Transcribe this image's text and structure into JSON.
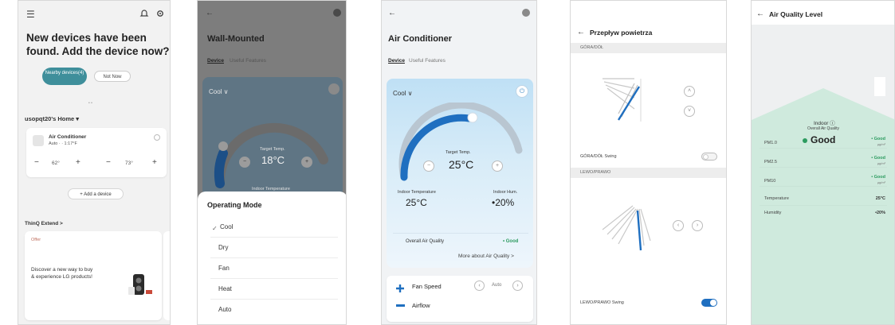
{
  "screen1": {
    "title": "New devices have been found. Add the device now?",
    "nearby_button": "Nearby devices(4)",
    "not_now_button": "Not Now",
    "page_dots": "• •",
    "home_label": "usopqt20's Home ▾",
    "device_name": "Air Conditioner",
    "device_status": "Auto · · 1:17°F",
    "minus": "−",
    "plus": "+",
    "temp_a": "62°",
    "temp_b": "73°",
    "add_device": "+ Add a device",
    "thinq_label": "ThinQ Extend >",
    "offer_label": "Offer",
    "promo_text": "Discover a new way to buy & experience LG products!"
  },
  "screen2": {
    "title": "Wall-Mounted",
    "tab_device": "Device",
    "tab_features": "Useful Features",
    "mode": "Cool ∨",
    "target_label": "Target Temp.",
    "target_value": "18°C",
    "partial_label": "Indoor Temperature",
    "sheet_title": "Operating Mode",
    "check": "✓",
    "modes": [
      "Cool",
      "Dry",
      "Fan",
      "Heat",
      "Auto"
    ]
  },
  "screen3": {
    "title": "Air Conditioner",
    "tab_device": "Device",
    "tab_features": "Useful Features",
    "mode": "Cool ∨",
    "target_label": "Target Temp.",
    "target_value": "25°C",
    "indoor_temp_label": "Indoor Temperature",
    "indoor_temp_value": "25°C",
    "indoor_hum_label": "Indoor Hum.",
    "indoor_hum_value": "•20%",
    "overall_label": "Overall Air Quality",
    "overall_value": "• Good",
    "more_link": "More about Air Quality >",
    "fan_speed_label": "Fan Speed",
    "fan_speed_value": "Auto",
    "airflow_label": "Airflow",
    "arrow_left": "‹",
    "arrow_right": "›"
  },
  "screen4": {
    "title": "Przepływ powietrza",
    "section_updown": "GÓRA/DÓŁ",
    "updown_swing": "GÓRA/DÓŁ Swing",
    "section_leftright": "LEWO/PRAWO",
    "leftright_swing": "LEWO/PRAWO Swing",
    "up_glyph": "˄",
    "down_glyph": "˅",
    "left_glyph": "‹",
    "right_glyph": "›"
  },
  "screen5": {
    "title": "Air Quality Level",
    "indoor_label": "Indoor ⓘ",
    "overall_label": "Overall Air Quality",
    "overall_value": "Good",
    "rows": [
      {
        "label": "PM1.0",
        "value": "• Good",
        "unit": "µg/m³"
      },
      {
        "label": "PM2.5",
        "value": "• Good",
        "unit": "µg/m³"
      },
      {
        "label": "PM10",
        "value": "• Good",
        "unit": "µg/m³"
      },
      {
        "label": "Temperature",
        "value": "25°C",
        "unit": ""
      },
      {
        "label": "Humidity",
        "value": "•20%",
        "unit": ""
      }
    ]
  },
  "colors": {
    "teal_button": "#3f8f9b",
    "arc_blue": "#1f6fc0",
    "good_green": "#2c9b5f",
    "mint_bg": "#cfeadd",
    "dim_overlay": "#7d7d7d"
  },
  "icons": {
    "menu": "menu-icon",
    "bell": "bell-icon",
    "settings": "gear-icon",
    "back": "back-arrow-icon",
    "power": "power-icon",
    "fan": "fan-icon",
    "airflow": "airflow-icon"
  }
}
